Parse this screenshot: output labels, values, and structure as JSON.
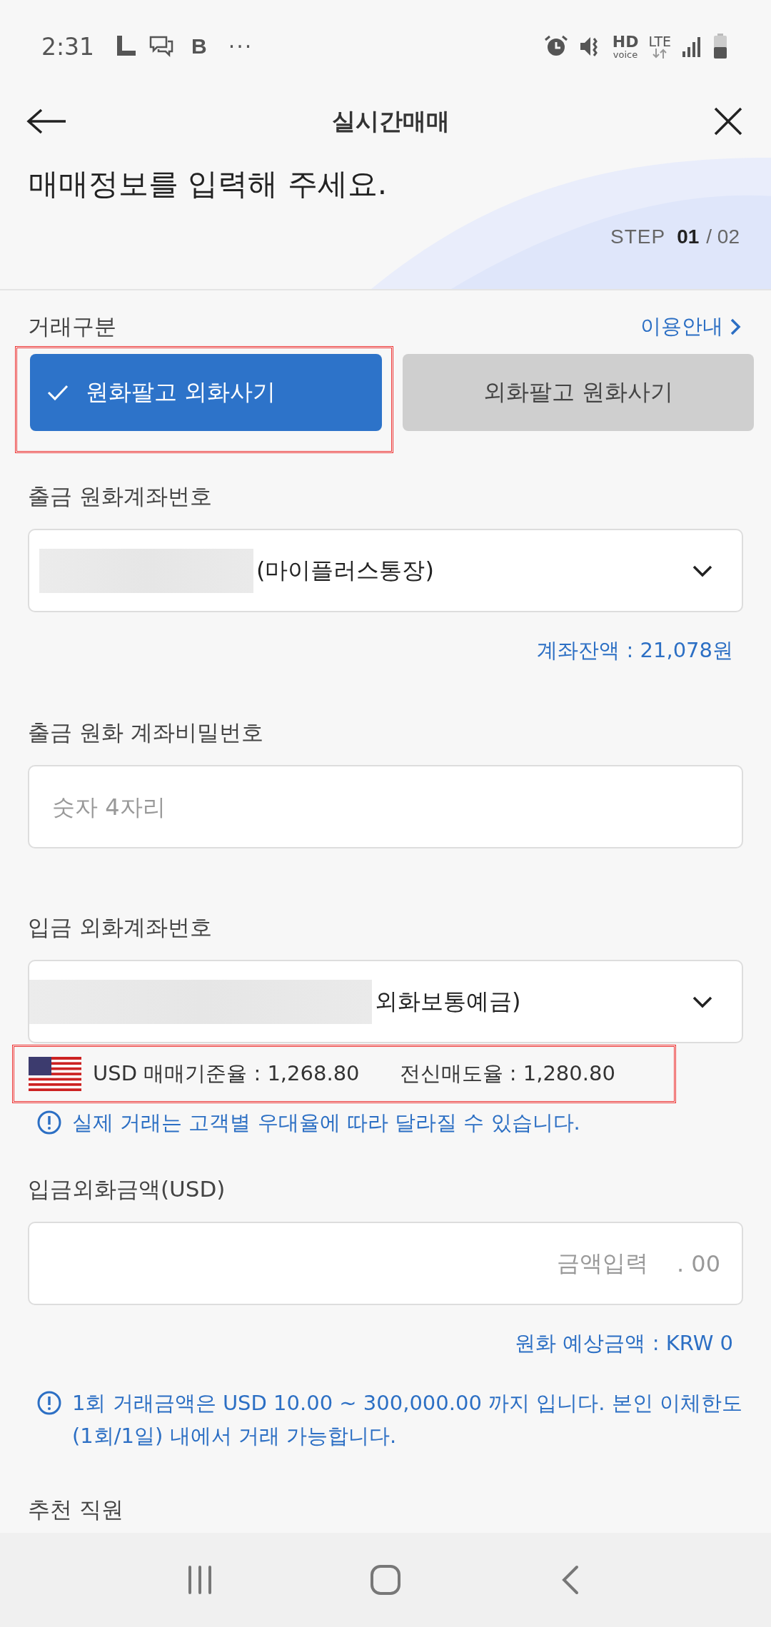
{
  "status_bar": {
    "time": "2:31",
    "app_letter": "B",
    "more": "···",
    "hd": "HD",
    "voice": "voice",
    "lte": "LTE"
  },
  "header": {
    "title": "실시간매매",
    "heading": "매매정보를 입력해 주세요.",
    "step_label": "STEP",
    "step_current": "01",
    "step_total": "/ 02"
  },
  "trade_type": {
    "label": "거래구분",
    "help_link": "이용안내",
    "options": [
      {
        "label": "원화팔고 외화사기",
        "selected": true
      },
      {
        "label": "외화팔고 원화사기",
        "selected": false
      }
    ]
  },
  "withdraw_account": {
    "label": "출금 원화계좌번호",
    "value": "(마이플러스통장)",
    "balance": "계좌잔액 : 21,078원"
  },
  "withdraw_password": {
    "label": "출금 원화 계좌비밀번호",
    "placeholder": "숫자 4자리"
  },
  "deposit_account": {
    "label": "입금 외화계좌번호",
    "value": "외화보통예금)"
  },
  "rates": {
    "base": "USD 매매기준율 : 1,268.80",
    "sell": "전신매도율 : 1,280.80",
    "notice": "실제 거래는 고객별 우대율에 따라 달라질 수 있습니다."
  },
  "amount": {
    "label": "입금외화금액(USD)",
    "placeholder": "금액입력",
    "decimals": ". 00",
    "estimate": "원화 예상금액 : KRW 0",
    "notice": "1회 거래금액은 USD 10.00 ~ 300,000.00 까지 입니다. 본인 이체한도(1회/1일) 내에서 거래 가능합니다."
  },
  "next_section": {
    "label": "추천 직원"
  }
}
